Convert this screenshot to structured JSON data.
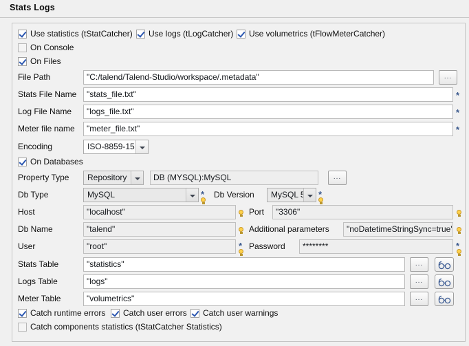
{
  "tab": {
    "label": "Stats  Logs"
  },
  "checkbox_row_top": [
    {
      "label": "Use statistics (tStatCatcher)",
      "checked": true,
      "name": "use-statistics"
    },
    {
      "label": "Use logs (tLogCatcher)",
      "checked": true,
      "name": "use-logs"
    },
    {
      "label": "Use volumetrics (tFlowMeterCatcher)",
      "checked": true,
      "name": "use-volumetrics"
    }
  ],
  "on_console": {
    "label": "On Console",
    "checked": false
  },
  "on_files": {
    "label": "On Files",
    "checked": true
  },
  "file_path": {
    "label": "File Path",
    "value": "\"C:/talend/Talend-Studio/workspace/.metadata\""
  },
  "stats_file_name": {
    "label": "Stats File Name",
    "value": "\"stats_file.txt\"",
    "required": "*"
  },
  "log_file_name": {
    "label": "Log File Name",
    "value": "\"logs_file.txt\"",
    "required": "*"
  },
  "meter_file_name": {
    "label": "Meter file name",
    "value": "\"meter_file.txt\"",
    "required": "*"
  },
  "encoding": {
    "label": "Encoding",
    "value": "ISO-8859-15"
  },
  "on_databases": {
    "label": "On Databases",
    "checked": true
  },
  "property_type": {
    "label": "Property Type",
    "value": "Repository",
    "repo_value": "DB (MYSQL):MySQL"
  },
  "db_type": {
    "label": "Db Type",
    "value": "MySQL",
    "required": "*"
  },
  "db_version": {
    "label": "Db Version",
    "value": "MySQL 5",
    "required": "*"
  },
  "host": {
    "label": "Host",
    "value": "\"localhost\""
  },
  "port": {
    "label": "Port",
    "value": "\"3306\""
  },
  "db_name": {
    "label": "Db Name",
    "value": "\"talend\""
  },
  "additional_parameters": {
    "label": "Additional parameters",
    "value": "\"noDatetimeStringSync=true\""
  },
  "user": {
    "label": "User",
    "value": "\"root\"",
    "required": "*"
  },
  "password": {
    "label": "Password",
    "value": "********",
    "required": "*"
  },
  "stats_table": {
    "label": "Stats Table",
    "value": "\"statistics\""
  },
  "logs_table": {
    "label": "Logs Table",
    "value": "\"logs\""
  },
  "meter_table": {
    "label": "Meter Table",
    "value": "\"volumetrics\""
  },
  "catch_row": [
    {
      "label": "Catch runtime errors",
      "checked": true,
      "name": "catch-runtime-errors"
    },
    {
      "label": "Catch user errors",
      "checked": true,
      "name": "catch-user-errors"
    },
    {
      "label": "Catch user warnings",
      "checked": true,
      "name": "catch-user-warnings"
    }
  ],
  "catch_components": {
    "label": "Catch components statistics (tStatCatcher Statistics)",
    "checked": false
  },
  "buttons": {
    "browse_dots": "...",
    "guess_schema_icon": "glasses-icon"
  },
  "colors": {
    "accent": "#2a56b0",
    "asterisk": "#3c5a8e",
    "bulb": "#ffd24a",
    "panel_bg": "#f1f1f1"
  }
}
